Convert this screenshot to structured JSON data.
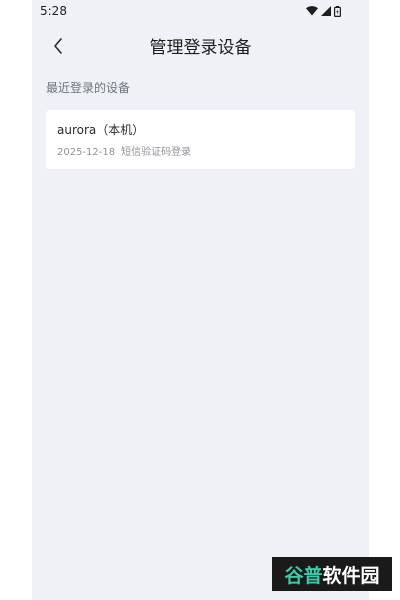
{
  "status_bar": {
    "time": "5:28",
    "icons": [
      "wifi-icon",
      "signal-icon",
      "battery-icon"
    ]
  },
  "header": {
    "back_icon": "chevron-left-icon",
    "title": "管理登录设备"
  },
  "section": {
    "label": "最近登录的设备"
  },
  "devices": [
    {
      "name": "aurora（本机）",
      "date": "2025-12-18",
      "method": "短信验证码登录"
    }
  ],
  "watermark": {
    "part1": "谷普",
    "part2": "软件园"
  },
  "colors": {
    "screen_background": "#eef2f7",
    "card_background": "#ffffff",
    "watermark_accent": "#3fc7a8"
  }
}
